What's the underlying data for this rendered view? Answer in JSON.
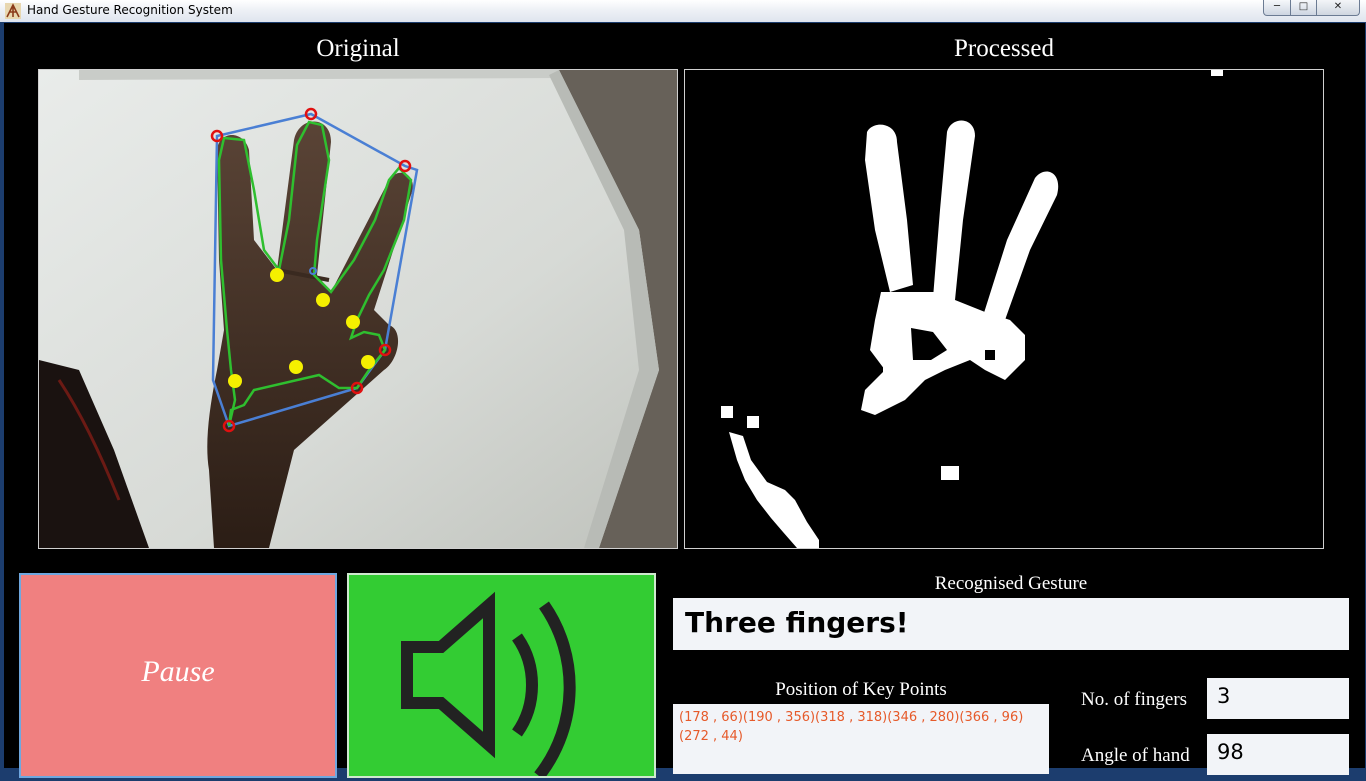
{
  "window": {
    "title": "Hand Gesture Recognition System",
    "icons": [
      "app-icon",
      "minimize-icon",
      "maximize-icon",
      "close-icon"
    ]
  },
  "panels": {
    "original_title": "Original",
    "processed_title": "Processed"
  },
  "controls": {
    "pause_label": "Pause",
    "speaker_icon": "speaker-icon",
    "pause_color": "#f08080",
    "speaker_color": "#33cc33"
  },
  "results": {
    "recognised_label": "Recognised Gesture",
    "recognised_value": "Three fingers!",
    "keypoints_label": "Position of Key Points",
    "keypoints_value": "(178 , 66)(190 , 356)(318 , 318)(346 , 280)(366 , 96)(272 , 44)",
    "fingers_label": "No. of fingers",
    "fingers_value": "3",
    "angle_label": "Angle of hand",
    "angle_value": "98",
    "keypoints_color": "#e65a2a"
  },
  "overlay_colors": {
    "hull": "#4a7fd4",
    "contour": "#2fbf2f",
    "fingertip": "#e01010",
    "defect": "#f5f000"
  }
}
